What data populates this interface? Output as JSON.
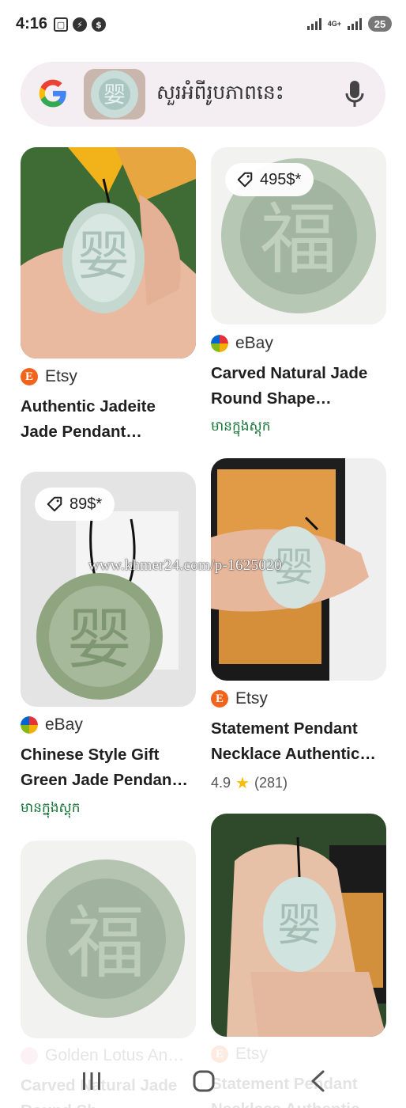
{
  "status_bar": {
    "time": "4:16",
    "notification_icons": [
      "screenshot-icon",
      "messenger-icon",
      "dollar-icon"
    ],
    "network": "4G+",
    "battery": "25"
  },
  "search": {
    "query": "សួរអំពីរូបភាពនេះ",
    "logo": "google-logo",
    "mic_icon": "mic-icon"
  },
  "results": [
    {
      "source": "Etsy",
      "source_icon": "etsy-icon",
      "title_lines": [
        "Authentic Jadeite",
        "Jade Pendant…"
      ]
    },
    {
      "price": "495$*",
      "source": "eBay",
      "source_icon": "ebay-icon",
      "title_lines": [
        "Carved Natural Jade",
        "Round Shape…"
      ],
      "stock": "មានក្នុងស្តុក"
    },
    {
      "price": "89$*",
      "source": "eBay",
      "source_icon": "ebay-icon",
      "title_lines": [
        "Chinese Style Gift",
        "Green Jade Pendan…"
      ],
      "stock": "មានក្នុងស្តុក"
    },
    {
      "source": "Etsy",
      "source_icon": "etsy-icon",
      "title_lines": [
        "Statement Pendant",
        "Necklace Authentic…"
      ],
      "rating": "4.9",
      "reviews": "(281)"
    },
    {
      "source": "Golden Lotus An…",
      "title_lines": [
        "Carved Natural Jade",
        "Round Sh…"
      ]
    },
    {
      "source": "Etsy",
      "source_icon": "etsy-icon",
      "title_lines": [
        "Statement Pendant",
        "Necklace Authentic…"
      ]
    }
  ],
  "watermark": "www.khmer24.com/p-1625020",
  "nav": {
    "icons": [
      "recents-icon",
      "home-icon",
      "back-icon"
    ]
  },
  "colors": {
    "jade": "#b9cfc7",
    "stock_green": "#137333",
    "etsy_orange": "#f1641e",
    "search_bg": "#f4eef2"
  }
}
